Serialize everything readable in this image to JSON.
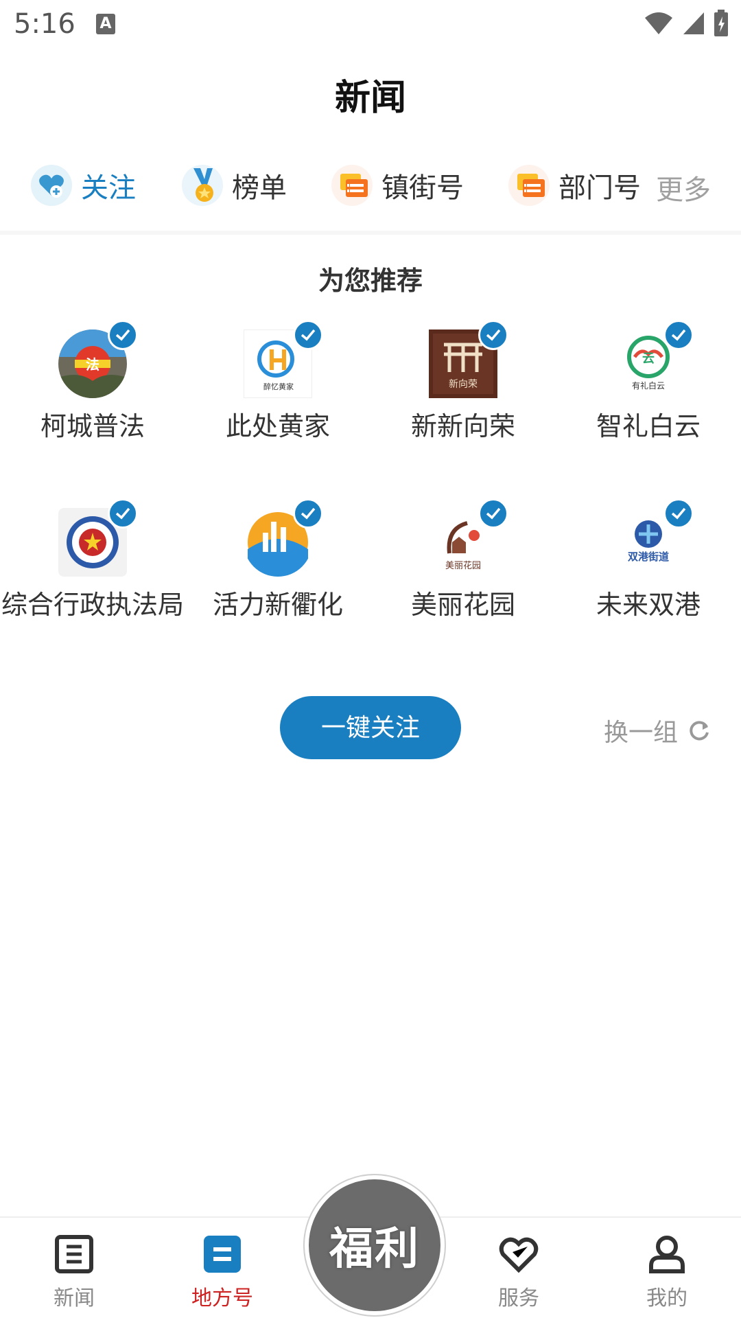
{
  "status": {
    "time": "5:16",
    "notification_icon": "A"
  },
  "page": {
    "title": "新闻"
  },
  "categories": [
    {
      "label": "关注",
      "icon": "heart-plus-icon",
      "active": true
    },
    {
      "label": "榜单",
      "icon": "medal-icon",
      "active": false
    },
    {
      "label": "镇街号",
      "icon": "chat-bubble-icon",
      "active": false
    },
    {
      "label": "部门号",
      "icon": "chat-bubble-icon",
      "active": false
    }
  ],
  "more_label": "更多",
  "recommend": {
    "title": "为您推荐",
    "items": [
      {
        "name": "柯城普法",
        "logo_text": "普法"
      },
      {
        "name": "此处黄家",
        "logo_text": "醉忆黄家"
      },
      {
        "name": "新新向荣",
        "logo_text": "新向荣"
      },
      {
        "name": "智礼白云",
        "logo_text": "有礼白云"
      },
      {
        "name": "综合行政执法局",
        "logo_text": ""
      },
      {
        "name": "活力新衢化",
        "logo_text": ""
      },
      {
        "name": "美丽花园",
        "logo_text": "美丽花园"
      },
      {
        "name": "未来双港",
        "logo_text": "双港街道"
      }
    ]
  },
  "actions": {
    "follow_all": "一键关注",
    "refresh": "换一组"
  },
  "bottom_nav": [
    {
      "label": "新闻",
      "icon": "newspaper-icon",
      "active": false
    },
    {
      "label": "地方号",
      "icon": "local-account-icon",
      "active": true
    },
    {
      "label": "服务",
      "icon": "heart-check-icon",
      "active": false
    },
    {
      "label": "我的",
      "icon": "person-icon",
      "active": false
    }
  ],
  "welfare": {
    "label": "福利"
  },
  "colors": {
    "accent": "#1a7fc0",
    "active_nav": "#cc2222",
    "welfare_bg": "#6b6b6b"
  }
}
